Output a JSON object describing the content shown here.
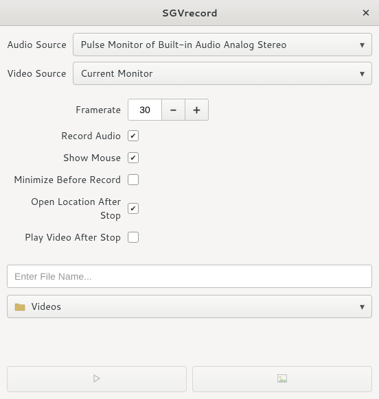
{
  "window": {
    "title": "SGVrecord"
  },
  "sources": {
    "audio_label": "Audio Source",
    "audio_value": "Pulse Monitor of Built-in Audio Analog Stereo",
    "video_label": "Video Source",
    "video_value": "Current Monitor"
  },
  "settings": {
    "framerate_label": "Framerate",
    "framerate_value": "30",
    "record_audio_label": "Record Audio",
    "record_audio_checked": true,
    "show_mouse_label": "Show Mouse",
    "show_mouse_checked": true,
    "minimize_label": "Minimize Before Record",
    "minimize_checked": false,
    "open_location_label": "Open Location After Stop",
    "open_location_checked": true,
    "play_video_label": "Play Video After Stop",
    "play_video_checked": false
  },
  "output": {
    "filename_placeholder": "Enter File Name...",
    "filename_value": "",
    "folder_label": "Videos"
  },
  "buttons": {
    "record_tooltip": "Record",
    "screenshot_tooltip": "Screenshot"
  }
}
